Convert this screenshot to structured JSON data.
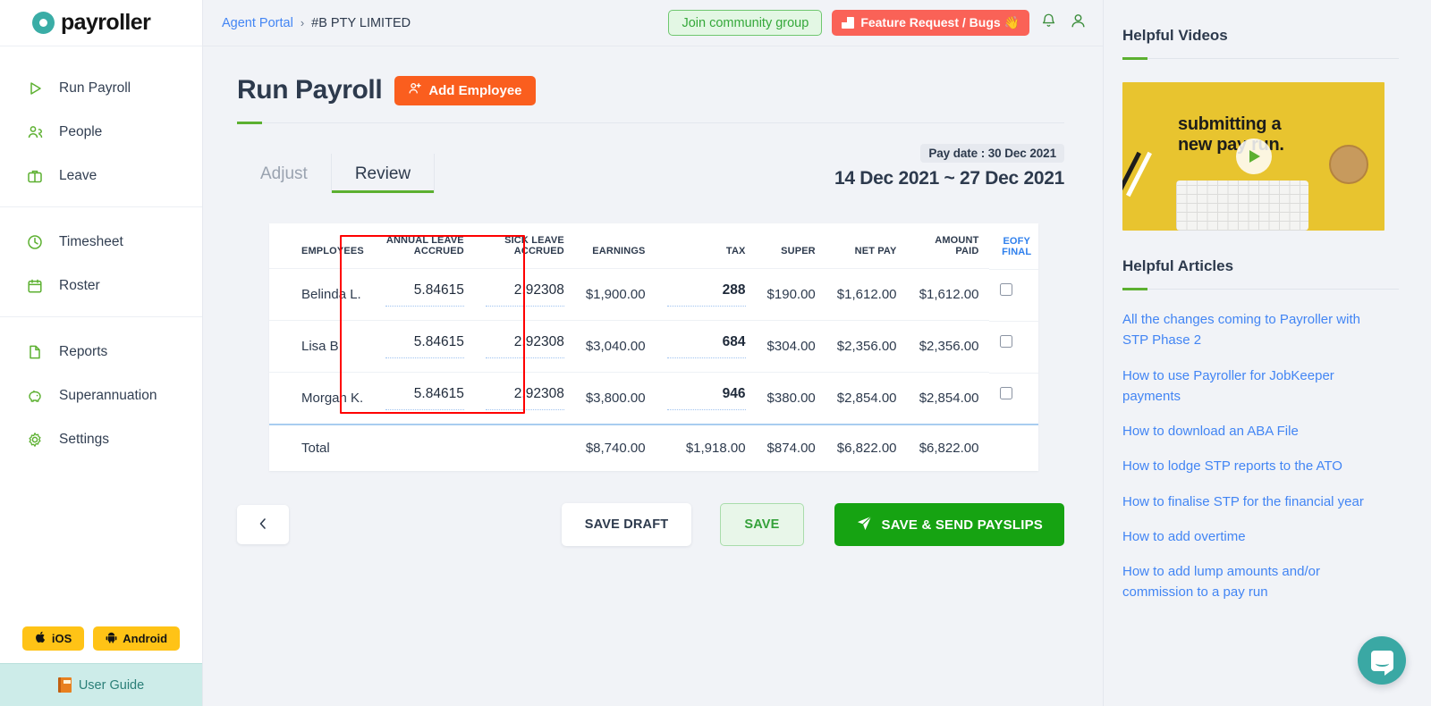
{
  "brand": {
    "name": "payroller",
    "logo_color": "#3aada6"
  },
  "sidebar": {
    "items": [
      {
        "label": "Run Payroll",
        "icon": "play-icon"
      },
      {
        "label": "People",
        "icon": "people-icon"
      },
      {
        "label": "Leave",
        "icon": "briefcase-icon"
      },
      {
        "label": "Timesheet",
        "icon": "clock-icon"
      },
      {
        "label": "Roster",
        "icon": "calendar-icon"
      },
      {
        "label": "Reports",
        "icon": "document-icon"
      },
      {
        "label": "Superannuation",
        "icon": "piggy-bank-icon"
      },
      {
        "label": "Settings",
        "icon": "gear-icon"
      }
    ],
    "ios_label": "iOS",
    "android_label": "Android",
    "user_guide_label": "User Guide"
  },
  "topbar": {
    "breadcrumb_root": "Agent Portal",
    "breadcrumb_sep": "›",
    "breadcrumb_current": "#B PTY LIMITED",
    "community_button": "Join community group",
    "feature_button": "Feature Request / Bugs 👋",
    "bell_icon": "notification-bell-icon",
    "account_icon": "user-account-icon"
  },
  "main": {
    "page_title": "Run Payroll",
    "add_employee_button": "Add Employee",
    "tabs": [
      {
        "label": "Adjust",
        "active": false
      },
      {
        "label": "Review",
        "active": true
      }
    ],
    "pay_date_chip": "Pay date : 30 Dec 2021",
    "pay_period": "14 Dec 2021 ~ 27 Dec 2021"
  },
  "table": {
    "columns": [
      "EMPLOYEES",
      "ANNUAL LEAVE ACCRUED",
      "SICK LEAVE ACCRUED",
      "EARNINGS",
      "TAX",
      "SUPER",
      "NET PAY",
      "AMOUNT PAID",
      "EOFY FINAL"
    ],
    "columns_split": {
      "annual_leave_l1": "ANNUAL LEAVE",
      "annual_leave_l2": "ACCRUED",
      "sick_leave_l1": "SICK LEAVE",
      "sick_leave_l2": "ACCRUED"
    },
    "rows": [
      {
        "employee": "Belinda L.",
        "annual_leave_accrued": "5.84615",
        "sick_leave_accrued": "2.92308",
        "earnings": "$1,900.00",
        "tax": "288",
        "super": "$190.00",
        "net_pay": "$1,612.00",
        "amount_paid": "$1,612.00",
        "eofy_final": false
      },
      {
        "employee": "Lisa B.",
        "annual_leave_accrued": "5.84615",
        "sick_leave_accrued": "2.92308",
        "earnings": "$3,040.00",
        "tax": "684",
        "super": "$304.00",
        "net_pay": "$2,356.00",
        "amount_paid": "$2,356.00",
        "eofy_final": false
      },
      {
        "employee": "Morgan K.",
        "annual_leave_accrued": "5.84615",
        "sick_leave_accrued": "2.92308",
        "earnings": "$3,800.00",
        "tax": "946",
        "super": "$380.00",
        "net_pay": "$2,854.00",
        "amount_paid": "$2,854.00",
        "eofy_final": false
      }
    ],
    "total": {
      "label": "Total",
      "annual_leave_accrued": "",
      "sick_leave_accrued": "",
      "earnings": "$8,740.00",
      "tax": "$1,918.00",
      "super": "$874.00",
      "net_pay": "$6,822.00",
      "amount_paid": "$6,822.00"
    },
    "highlight_color": "#ff0000"
  },
  "actions": {
    "back_icon": "chevron-left-icon",
    "save_draft": "SAVE DRAFT",
    "save": "SAVE",
    "save_send_payslips": "SAVE & SEND PAYSLIPS"
  },
  "right_panel": {
    "videos_heading": "Helpful Videos",
    "video_caption_l1": "submitting a",
    "video_caption_l2": "new pay run.",
    "articles_heading": "Helpful Articles",
    "articles": [
      "All the changes coming to Payroller with STP Phase 2",
      "How to use Payroller for JobKeeper payments",
      "How to download an ABA File",
      "How to lodge STP reports to the ATO",
      "How to finalise STP for the financial year",
      "How to add overtime",
      "How to add lump amounts and/or commission to a pay run"
    ]
  },
  "chat": {
    "icon": "chat-bubble-icon"
  }
}
